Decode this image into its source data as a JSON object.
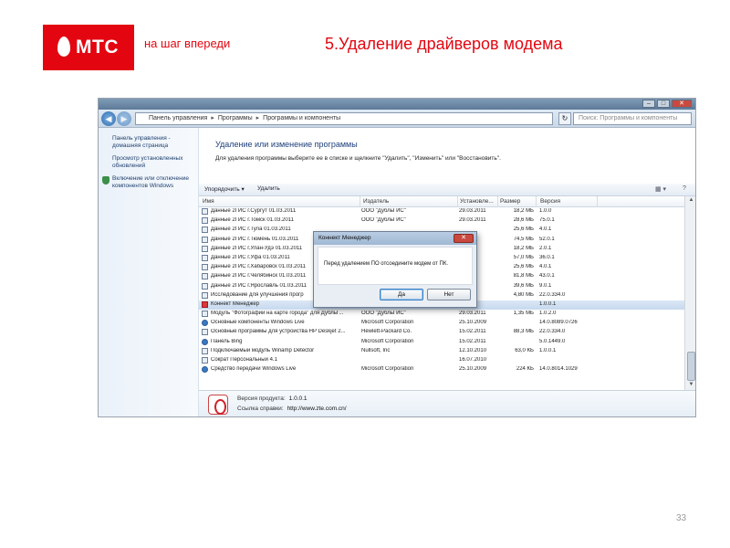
{
  "slide": {
    "logo_text": "МТС",
    "slogan": "на шаг впереди",
    "title": "5.Удаление драйверов модема",
    "page_number": "33"
  },
  "window": {
    "breadcrumb": [
      "Панель управления",
      "Программы",
      "Программы и компоненты"
    ],
    "search_placeholder": "Поиск: Программы и компоненты",
    "left_links": [
      "Панель управления - домашняя страница",
      "Просмотр установленных обновлений",
      "Включение или отключение компонентов Windows"
    ],
    "content_title": "Удаление или изменение программы",
    "content_desc": "Для удаления программы выберите ее в списке и щелкните \"Удалить\", \"Изменить\" или \"Восстановить\".",
    "toolbar": {
      "organize": "Упорядочить ▾",
      "uninstall": "Удалить"
    },
    "columns": {
      "name": "Имя",
      "publisher": "Издатель",
      "installed": "Установле...",
      "size": "Размер",
      "version": "Версия"
    },
    "programs": [
      {
        "name": "Данные 2ГИС г.Сургут 01.03.2011",
        "publisher": "ООО \"ДубльГИС\"",
        "installed": "29.03.2011",
        "size": "18,2 МБ",
        "version": "1.0.0",
        "icon": "package-icon"
      },
      {
        "name": "Данные 2ГИС г.Томск 01.03.2011",
        "publisher": "ООО \"ДубльГИС\"",
        "installed": "29.03.2011",
        "size": "28,6 МБ",
        "version": "75.0.1",
        "icon": "package-icon"
      },
      {
        "name": "Данные 2ГИС г.Тула 01.03.2011",
        "publisher": "",
        "installed": "",
        "size": "25,6 МБ",
        "version": "4.0.1",
        "icon": "package-icon"
      },
      {
        "name": "Данные 2ГИС г.Тюмень 01.03.2011",
        "publisher": "",
        "installed": "",
        "size": "74,5 МБ",
        "version": "52.0.1",
        "icon": "package-icon"
      },
      {
        "name": "Данные 2ГИС г.Улан-Удэ 01.03.2011",
        "publisher": "",
        "installed": "",
        "size": "18,2 МБ",
        "version": "2.0.1",
        "icon": "package-icon"
      },
      {
        "name": "Данные 2ГИС г.Уфа 01.03.2011",
        "publisher": "",
        "installed": "",
        "size": "57,0 МБ",
        "version": "36.0.1",
        "icon": "package-icon"
      },
      {
        "name": "Данные 2ГИС г.Хабаровск 01.03.2011",
        "publisher": "",
        "installed": "",
        "size": "25,6 МБ",
        "version": "4.0.1",
        "icon": "package-icon"
      },
      {
        "name": "Данные 2ГИС г.Челябинск 01.03.2011",
        "publisher": "",
        "installed": "",
        "size": "81,8 МБ",
        "version": "43.0.1",
        "icon": "package-icon"
      },
      {
        "name": "Данные 2ГИС г.Ярославль 01.03.2011",
        "publisher": "",
        "installed": "",
        "size": "39,6 МБ",
        "version": "9.0.1",
        "icon": "package-icon"
      },
      {
        "name": "Исследование для улучшения прогр",
        "publisher": "",
        "installed": "",
        "size": "4,80 МБ",
        "version": "22.0.334.0",
        "icon": "package-icon"
      },
      {
        "name": "Коннект Менеджер",
        "publisher": "",
        "installed": "",
        "size": "",
        "version": "1.0.0.1",
        "icon": "connect-manager-icon",
        "selected": true
      },
      {
        "name": "Модуль \"Фотографии на карте города\" для ДубльГ...",
        "publisher": "ООО \"ДубльГИС\"",
        "installed": "29.03.2011",
        "size": "1,35 МБ",
        "version": "1.0.2.0",
        "icon": "package-icon"
      },
      {
        "name": "Основные компоненты Windows Live",
        "publisher": "Microsoft Corporation",
        "installed": "25.10.2009",
        "size": "",
        "version": "14.0.8089.0726",
        "icon": "windows-live-icon"
      },
      {
        "name": "Основные программы для устройства HP Deskjet 2...",
        "publisher": "Hewlett-Packard Co.",
        "installed": "15.02.2011",
        "size": "88,3 МБ",
        "version": "22.0.334.0",
        "icon": "package-icon"
      },
      {
        "name": "Панель Bing",
        "publisher": "Microsoft Corporation",
        "installed": "15.02.2011",
        "size": "",
        "version": "5.0.1449.0",
        "icon": "windows-live-icon"
      },
      {
        "name": "Подключаемый модуль Winamp Detector",
        "publisher": "Nullsoft, Inc",
        "installed": "12.10.2010",
        "size": "63,0 КБ",
        "version": "1.0.0.1",
        "icon": "package-icon"
      },
      {
        "name": "Сократ Персональный 4.1",
        "publisher": "",
        "installed": "16.07.2010",
        "size": "",
        "version": "",
        "icon": "package-icon"
      },
      {
        "name": "Средство передачи Windows Live",
        "publisher": "Microsoft Corporation",
        "installed": "25.10.2009",
        "size": "224 КБ",
        "version": "14.0.8014.1029",
        "icon": "windows-live-icon"
      }
    ],
    "details": {
      "version_label": "Версия продукта:",
      "version_value": "1.0.0.1",
      "help_label": "Ссылка справки:",
      "help_value": "http://www.zte.com.cn/"
    }
  },
  "dialog": {
    "title": "Коннект Менеджер",
    "message": "Перед удалением ПО отсоедините модем от ПК.",
    "yes_label": "Да",
    "no_label": "Нет"
  }
}
